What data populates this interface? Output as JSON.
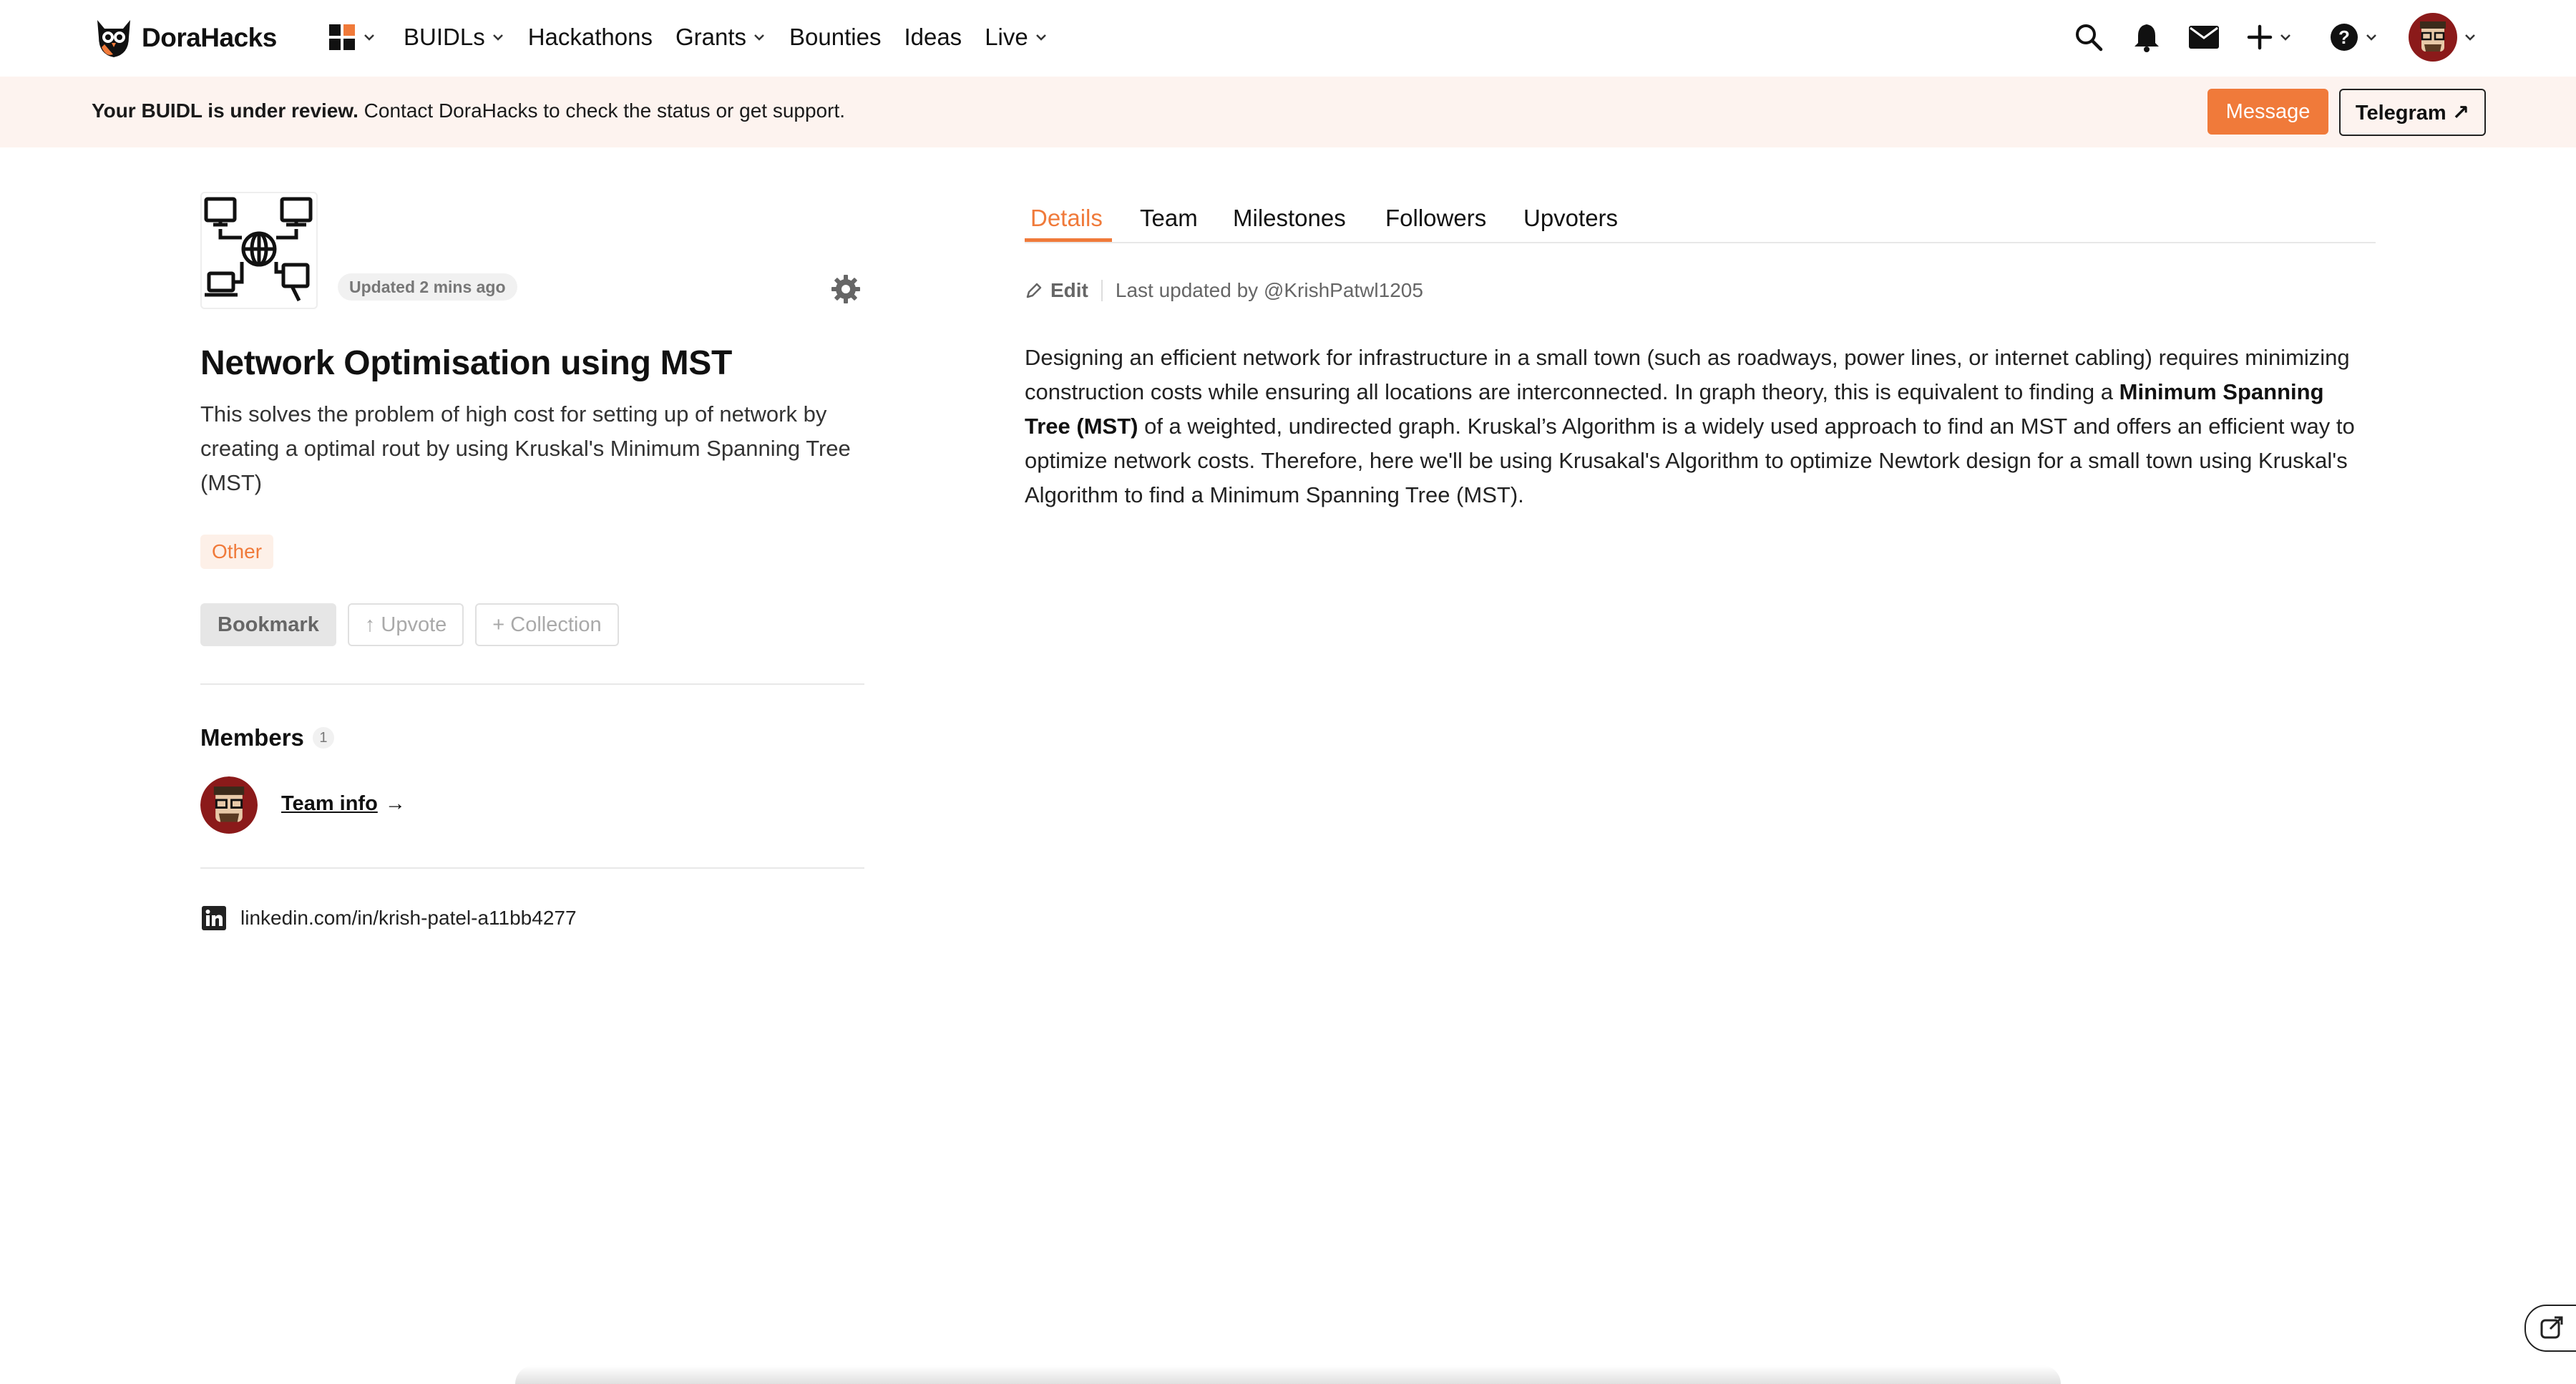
{
  "brand": {
    "name": "DoraHacks",
    "accent": "#f07a3a"
  },
  "nav": {
    "items": [
      {
        "label": "BUIDLs",
        "has_menu": true
      },
      {
        "label": "Hackathons",
        "has_menu": false
      },
      {
        "label": "Grants",
        "has_menu": true
      },
      {
        "label": "Bounties",
        "has_menu": false
      },
      {
        "label": "Ideas",
        "has_menu": false
      },
      {
        "label": "Live",
        "has_menu": true
      }
    ],
    "right_icons": [
      "search-icon",
      "bell-icon",
      "mail-icon",
      "plus-icon",
      "help-icon",
      "avatar"
    ]
  },
  "banner": {
    "bold": "Your BUIDL is under review.",
    "text": " Contact DoraHacks to check the status or get support.",
    "message_label": "Message",
    "telegram_label": "Telegram ↗"
  },
  "project": {
    "updated": "Updated 2 mins ago",
    "title": "Network Optimisation using MST",
    "description": "This solves the problem of high cost for setting up of network by creating a optimal rout by using Kruskal's Minimum Spanning Tree (MST)",
    "tag": "Other",
    "actions": {
      "bookmark": "Bookmark",
      "upvote": "↑ Upvote",
      "collection": "+ Collection"
    },
    "members_title": "Members",
    "members_count": "1",
    "team_info": "Team info",
    "team_info_arrow": "→",
    "linkedin": "linkedin.com/in/krish-patel-a11bb4277"
  },
  "tabs": [
    "Details",
    "Team",
    "Milestones",
    "Followers",
    "Upvoters"
  ],
  "details": {
    "edit_label": "Edit",
    "last_updated": "Last updated by @KrishPatwl1205",
    "p1": "Designing an efficient network for infrastructure in a small town (such as roadways, power lines, or internet cabling) requires minimizing construction costs while ensuring all locations are interconnected. In graph theory, this is equivalent to finding a ",
    "bold": "Minimum Spanning Tree (MST)",
    "p2": " of a weighted, undirected graph. Kruskal’s Algorithm is a widely used approach to find an MST and offers an efficient way to optimize network costs. Therefore, here we'll be using Krusakal's Algorithm to optimize Newtork design for a small town using Kruskal's Algorithm to find a Minimum Spanning Tree (MST)."
  }
}
